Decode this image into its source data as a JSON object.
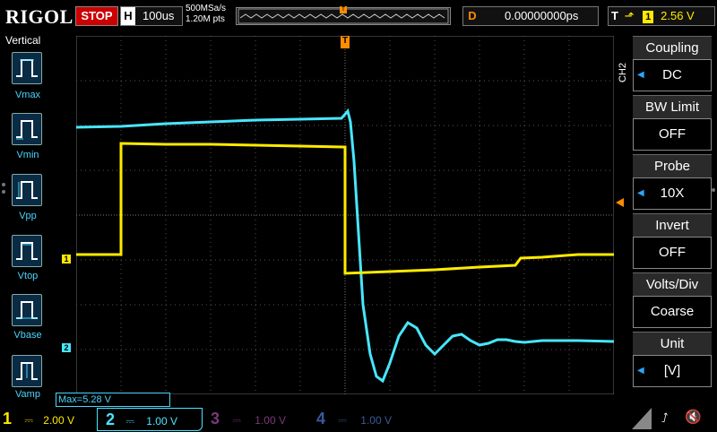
{
  "top": {
    "brand": "RIGOL",
    "run_state": "STOP",
    "horizontal_label": "H",
    "horizontal_scale": "100us",
    "sample_rate": "500MSa/s",
    "memory_depth": "1.20M pts",
    "delay_label": "D",
    "delay_value": "0.00000000ps",
    "trigger_label": "T",
    "trigger_source": "1",
    "trigger_level": "2.56 V"
  },
  "left": {
    "title": "Vertical",
    "measurements": [
      {
        "label": "Vmax"
      },
      {
        "label": "Vmin"
      },
      {
        "label": "Vpp"
      },
      {
        "label": "Vtop"
      },
      {
        "label": "Vbase"
      },
      {
        "label": "Vamp"
      }
    ]
  },
  "right": {
    "channel_tag": "CH2",
    "menu": [
      {
        "title": "Coupling",
        "value": "DC"
      },
      {
        "title": "BW Limit",
        "value": "OFF"
      },
      {
        "title": "Probe",
        "value": "10X"
      },
      {
        "title": "Invert",
        "value": "OFF"
      },
      {
        "title": "Volts/Div",
        "value": "Coarse"
      },
      {
        "title": "Unit",
        "value": "[V]"
      }
    ]
  },
  "measurement_readout": "Max=5.28 V",
  "channels": [
    {
      "num": "1",
      "scale": "2.00 V",
      "color": "#ffea00"
    },
    {
      "num": "2",
      "scale": "1.00 V",
      "color": "#48e6ff"
    },
    {
      "num": "3",
      "scale": "1.00 V",
      "color": "#8a3a8a"
    },
    {
      "num": "4",
      "scale": "1.00 V",
      "color": "#3a5a9a"
    }
  ],
  "marker_labels": {
    "ch1": "1",
    "ch2": "2",
    "trigger_top": "T"
  },
  "colors": {
    "ch1": "#ffea00",
    "ch2": "#48e6ff",
    "trigger": "#ff8c00",
    "grid": "#6a6a6a"
  }
}
